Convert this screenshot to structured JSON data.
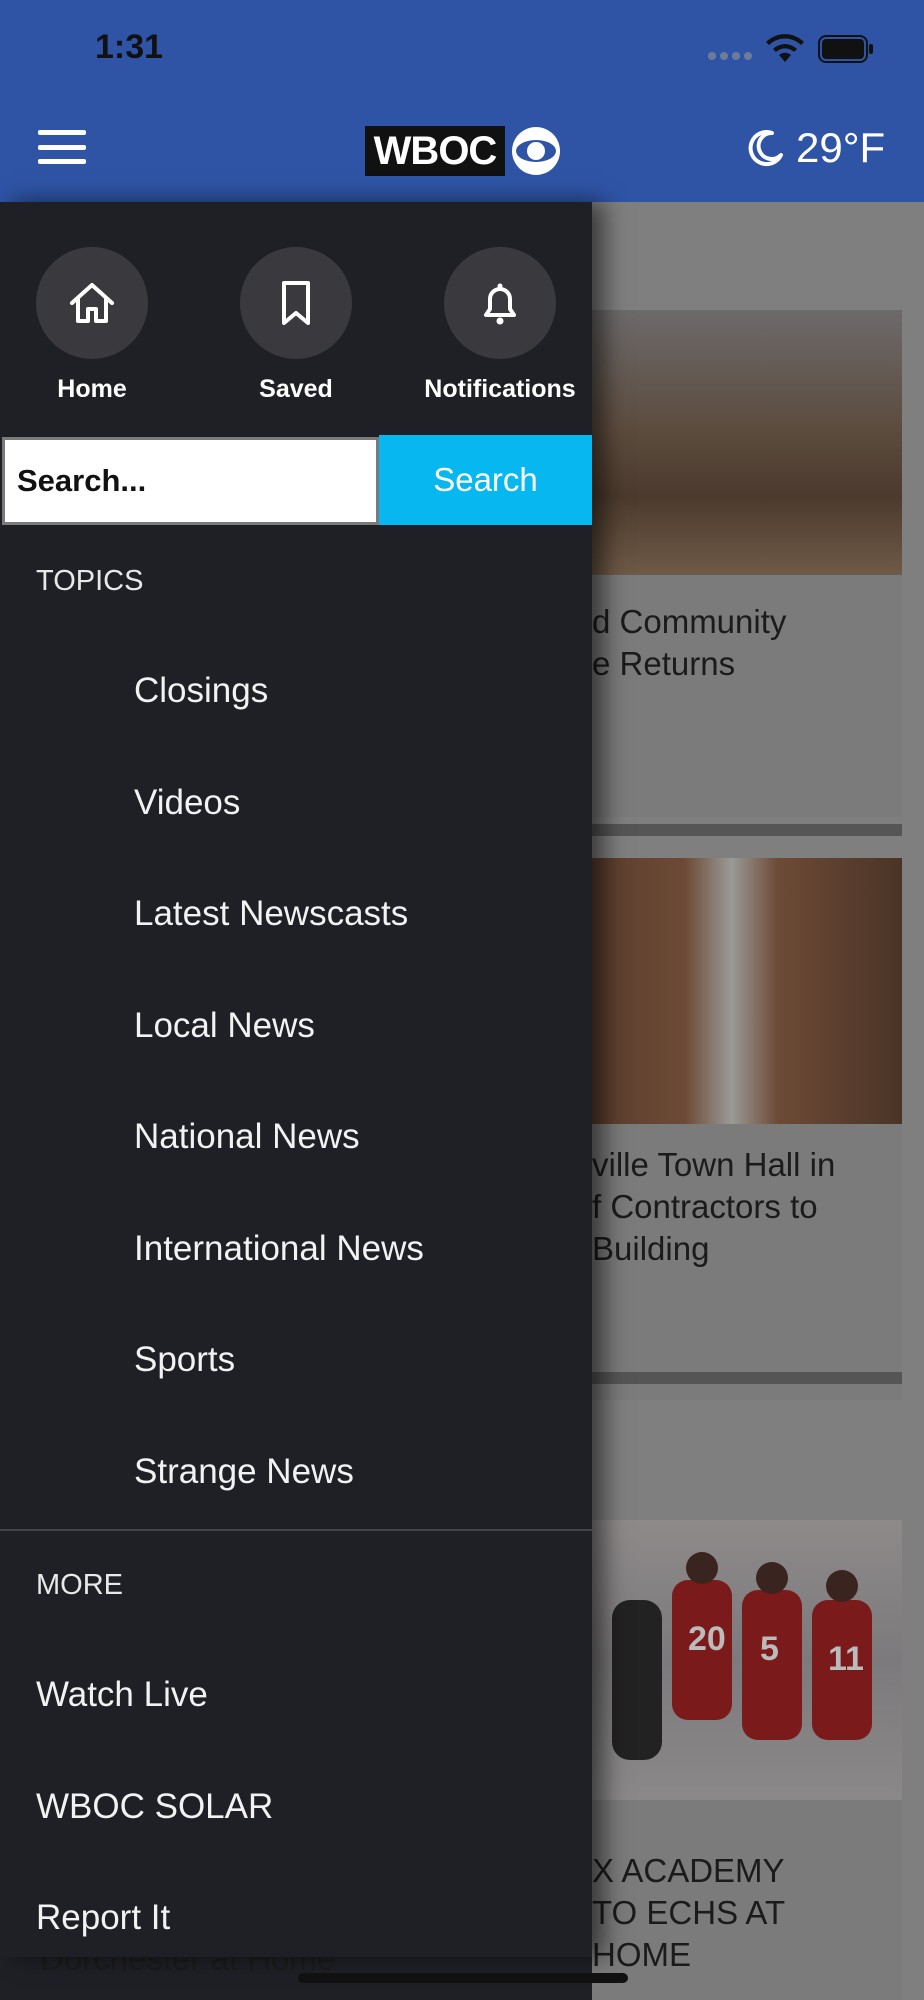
{
  "status_bar": {
    "time": "1:31"
  },
  "header": {
    "logo_text": "WBOC",
    "weather_temp": "29°F",
    "icons": {
      "menu": "hamburger-menu-icon",
      "weather": "moon-icon"
    }
  },
  "drawer": {
    "quick_links": [
      {
        "label": "Home",
        "icon": "home-icon"
      },
      {
        "label": "Saved",
        "icon": "bookmark-icon"
      },
      {
        "label": "Notifications",
        "icon": "bell-icon"
      }
    ],
    "search": {
      "placeholder": "Search...",
      "button_label": "Search"
    },
    "topics_header": "TOPICS",
    "topics": [
      "Closings",
      "Videos",
      "Latest Newscasts",
      "Local News",
      "National News",
      "International News",
      "Sports",
      "Strange News"
    ],
    "more_header": "MORE",
    "more_items": [
      "Watch Live",
      "WBOC SOLAR",
      "Report It"
    ]
  },
  "background_cards": [
    {
      "title_line1": "d Community",
      "title_line2": "e Returns"
    },
    {
      "title_line1": "ville Town Hall in",
      "title_line2": "f Contractors to",
      "title_line3": "Building"
    },
    {
      "title_line1": "X ACADEMY",
      "title_line2": "TO ECHS AT",
      "title_line3": "HOME"
    }
  ],
  "background_bottom_left": "Dorchester at Home",
  "colors": {
    "header_bg": "#2f54a6",
    "drawer_bg": "#1f2026",
    "search_button": "#06b8ef"
  }
}
